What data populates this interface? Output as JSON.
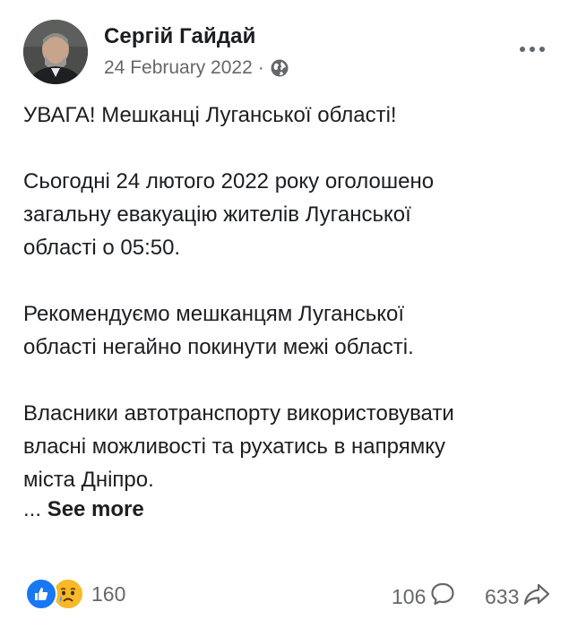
{
  "author": {
    "name": "Сергій Гайдай",
    "avatar_icon": "profile-photo-icon"
  },
  "meta": {
    "date": "24 February 2022",
    "separator": "·",
    "audience_icon": "globe-icon"
  },
  "more_icon": "more-options-icon",
  "post": {
    "paragraphs": [
      "УВАГА! Мешканці Луганської області!",
      "Сьогодні 24 лютого 2022 року оголошено\nзагальну евакуацію жителів Луганської\nобласті о 05:50.",
      "Рекомендуємо мешканцям Луганської\nобласті негайно покинути межі області.",
      "Власники автотранспорту використовувати\nвласні можливості та рухатись в напрямку\nміста Дніпро."
    ],
    "ellipsis": "...",
    "see_more": "See more"
  },
  "footer": {
    "reactions": {
      "icons": [
        "like-icon",
        "sad-icon"
      ],
      "count": "160"
    },
    "comments": {
      "count": "106",
      "icon": "comment-icon"
    },
    "shares": {
      "count": "633",
      "icon": "share-icon"
    }
  },
  "colors": {
    "text": "#1c1e21",
    "secondary": "#65676b",
    "like": "#1877f2",
    "sad": "#f7b928"
  }
}
